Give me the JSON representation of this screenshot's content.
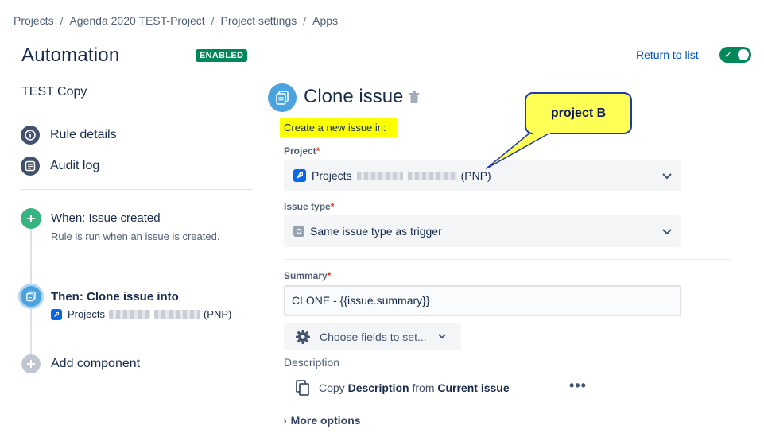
{
  "breadcrumb": {
    "items": [
      "Projects",
      "Agenda 2020 TEST-Project",
      "Project settings",
      "Apps"
    ],
    "separator": "/"
  },
  "header": {
    "title": "Automation",
    "badge": "ENABLED",
    "return_link": "Return to list",
    "toggle_on": true
  },
  "sidebar": {
    "rule_name": "TEST Copy",
    "nav": [
      {
        "label": "Rule details",
        "icon": "info-icon"
      },
      {
        "label": "Audit log",
        "icon": "list-icon"
      }
    ],
    "steps": {
      "trigger": {
        "title": "When: Issue created",
        "sub": "Rule is run when an issue is created."
      },
      "action": {
        "title": "Then: Clone issue into",
        "project_prefix": "Projects",
        "project_suffix": "(PNP)"
      },
      "add": {
        "label": "Add component"
      }
    }
  },
  "main": {
    "title": "Clone issue",
    "highlight_text": "Create a new issue in:",
    "project": {
      "label": "Project",
      "required": "*",
      "prefix": "Projects",
      "suffix": "(PNP)"
    },
    "issue_type": {
      "label": "Issue type",
      "required": "*",
      "value": "Same issue type as trigger"
    },
    "summary": {
      "label": "Summary",
      "required": "*",
      "value": "CLONE - {{issue.summary}}"
    },
    "choose_fields": "Choose fields to set...",
    "description": {
      "label": "Description",
      "copy": "Copy",
      "field": "Description",
      "from": "from",
      "source": "Current issue",
      "more": "•••"
    },
    "more_options": "More options",
    "more_options_chevron": "›"
  },
  "annotation": {
    "callout_text": "project B"
  },
  "colors": {
    "accent": "#0052cc",
    "enabled": "#00875a",
    "highlight": "#fbff00",
    "action_icon": "#4aa3df",
    "trigger_icon": "#36b37e"
  }
}
